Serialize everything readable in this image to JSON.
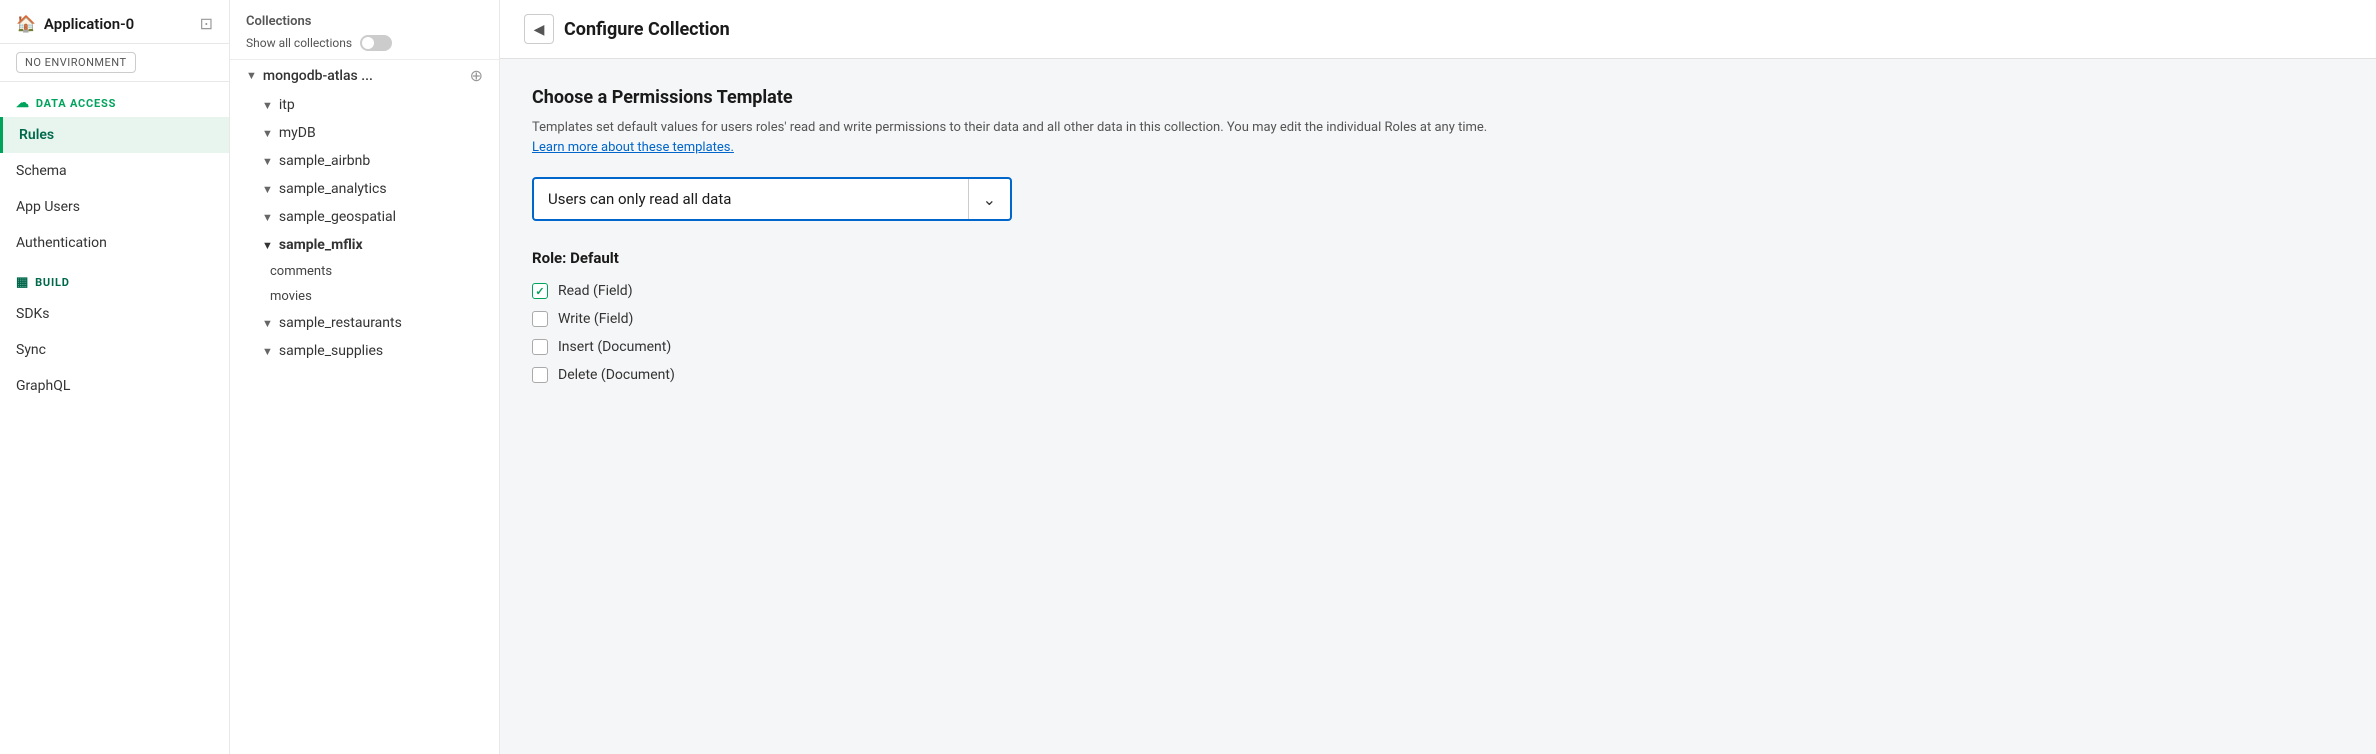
{
  "sidebar": {
    "app_title": "Application-0",
    "environment_badge": "NO ENVIRONMENT",
    "data_access_label": "DATA ACCESS",
    "data_access_icon": "☁",
    "nav_items": [
      {
        "id": "rules",
        "label": "Rules",
        "active": true
      },
      {
        "id": "schema",
        "label": "Schema",
        "active": false
      },
      {
        "id": "app-users",
        "label": "App Users",
        "active": false
      },
      {
        "id": "authentication",
        "label": "Authentication",
        "active": false
      }
    ],
    "build_label": "BUILD",
    "build_icon": "▦",
    "build_items": [
      {
        "id": "sdks",
        "label": "SDKs"
      },
      {
        "id": "sync",
        "label": "Sync"
      },
      {
        "id": "graphql",
        "label": "GraphQL"
      }
    ]
  },
  "collections": {
    "title": "Collections",
    "show_all_label": "Show all collections",
    "databases": [
      {
        "name": "mongodb-atlas ...",
        "expanded": true,
        "children": [
          {
            "name": "itp",
            "type": "db"
          },
          {
            "name": "myDB",
            "type": "db"
          },
          {
            "name": "sample_airbnb",
            "type": "db"
          },
          {
            "name": "sample_analytics",
            "type": "db"
          },
          {
            "name": "sample_geospatial",
            "type": "db"
          },
          {
            "name": "sample_mflix",
            "type": "db",
            "bold": true,
            "expanded": true,
            "children": [
              {
                "name": "comments"
              },
              {
                "name": "movies"
              }
            ]
          },
          {
            "name": "sample_restaurants",
            "type": "db"
          },
          {
            "name": "sample_supplies",
            "type": "db"
          }
        ]
      }
    ]
  },
  "configure": {
    "header_title": "Configure Collection",
    "back_arrow": "◀",
    "permissions_heading": "Choose a Permissions Template",
    "permissions_desc": "Templates set default values for users roles' read and write permissions to their data and all other data in this collection. You may edit the individual Roles at any time.",
    "learn_more_text": "Learn more about these templates.",
    "selected_template": "Users can only read all data",
    "dropdown_arrow": "⌄",
    "role_section_title": "Role: Default",
    "role_items": [
      {
        "label": "Read (Field)",
        "checked": true
      },
      {
        "label": "Write (Field)",
        "checked": false
      },
      {
        "label": "Insert (Document)",
        "checked": false
      },
      {
        "label": "Delete (Document)",
        "checked": false
      }
    ]
  }
}
